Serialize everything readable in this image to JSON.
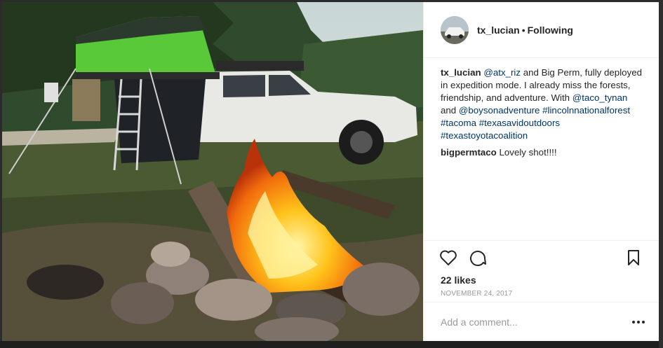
{
  "post": {
    "username": "tx_lucian",
    "separator": "•",
    "follow_status": "Following"
  },
  "caption": {
    "user": "tx_lucian",
    "mention1": "@atx_riz",
    "text1": " and Big Perm, fully deployed in expedition mode. I already miss the forests, friendship, and adventure. With ",
    "mention2": "@taco_tynan",
    "text2": " and ",
    "mention3": "@boysonadventure",
    "tags": [
      "#lincolnnationalforest",
      "#tacoma",
      "#texasavidoutdoors",
      "#texastoyotacoalition"
    ]
  },
  "comments": [
    {
      "user": "bigpermtaco",
      "text": "Lovely shot!!!!"
    }
  ],
  "stats": {
    "likes": "22 likes",
    "date": "NOVEMBER 24, 2017"
  },
  "add_comment": {
    "placeholder": "Add a comment..."
  },
  "icons": [
    "heart-icon",
    "comment-icon",
    "bookmark-icon",
    "more-icon"
  ]
}
